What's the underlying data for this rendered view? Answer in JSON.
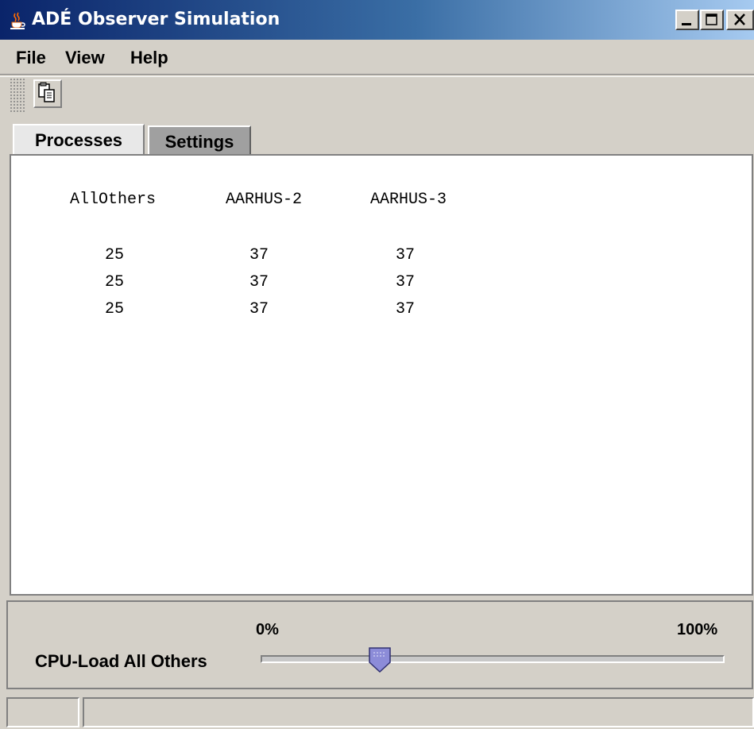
{
  "window": {
    "title": "ADÉ Observer Simulation",
    "icon": "java-cup-icon",
    "controls": [
      "minimize-icon",
      "maximize-icon",
      "close-icon"
    ]
  },
  "menu": {
    "items": [
      "File",
      "View",
      "Help"
    ]
  },
  "toolbar": {
    "buttons": [
      {
        "icon": "copy-icon"
      }
    ]
  },
  "tabs": [
    {
      "label": "Processes",
      "selected": true
    },
    {
      "label": "Settings",
      "selected": false
    }
  ],
  "processes_table": {
    "headers": [
      "AllOthers",
      "AARHUS-2",
      "AARHUS-3"
    ],
    "rows": [
      [
        "25",
        "37",
        "37"
      ],
      [
        "25",
        "37",
        "37"
      ],
      [
        "25",
        "37",
        "37"
      ]
    ]
  },
  "cpu_slider": {
    "label": "CPU-Load All Others",
    "min_label": "0%",
    "max_label": "100%",
    "value_fraction": 0.25
  },
  "colors": {
    "title_gradient_start": "#0a246a",
    "title_gradient_end": "#a6caf0",
    "window_bg": "#d4d0c8",
    "thumb": "#8c8cd8"
  }
}
